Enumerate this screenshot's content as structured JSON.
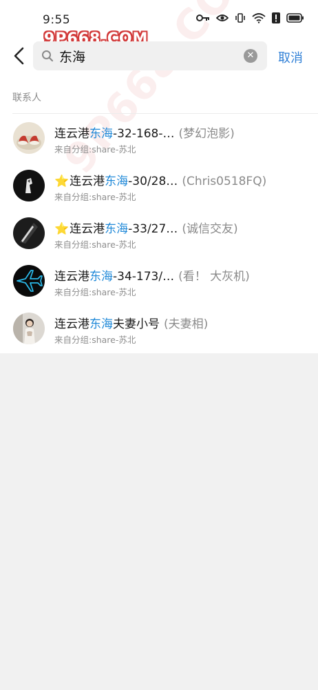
{
  "status_bar": {
    "time": "9:55"
  },
  "watermark": "9P668.COM",
  "header": {
    "search_value": "东海",
    "cancel_label": "取消"
  },
  "section": {
    "label": "联系人"
  },
  "contacts": [
    {
      "prefix": "连云港",
      "highlight": "东海",
      "rest": "-32-168-…",
      "nickname": "(梦幻泡影)",
      "group": "来自分组:share-苏北",
      "starred": false,
      "avatar": "shoes-avatar"
    },
    {
      "prefix": "连云港",
      "highlight": "东海",
      "rest": "-30/28…",
      "nickname": "(Chris0518FQ)",
      "group": "来自分组:share-苏北",
      "starred": true,
      "avatar": "dark-avatar"
    },
    {
      "prefix": "连云港",
      "highlight": "东海",
      "rest": "-33/27…",
      "nickname": "(诚信交友)",
      "group": "来自分组:share-苏北",
      "starred": true,
      "avatar": "dark-abstract-avatar"
    },
    {
      "prefix": "连云港",
      "highlight": "东海",
      "rest": "-34-173/…",
      "nickname": "(看！ 大灰机)",
      "group": "来自分组:share-苏北",
      "starred": false,
      "avatar": "airplane-avatar"
    },
    {
      "prefix": "连云港",
      "highlight": "东海",
      "rest": "夫妻小号",
      "nickname": "(夫妻相)",
      "group": "来自分组:share-苏北",
      "starred": false,
      "avatar": "photo-avatar"
    }
  ],
  "colors": {
    "accent": "#2f7fd6",
    "highlight": "#1e88d8",
    "star": "#f2b500"
  }
}
